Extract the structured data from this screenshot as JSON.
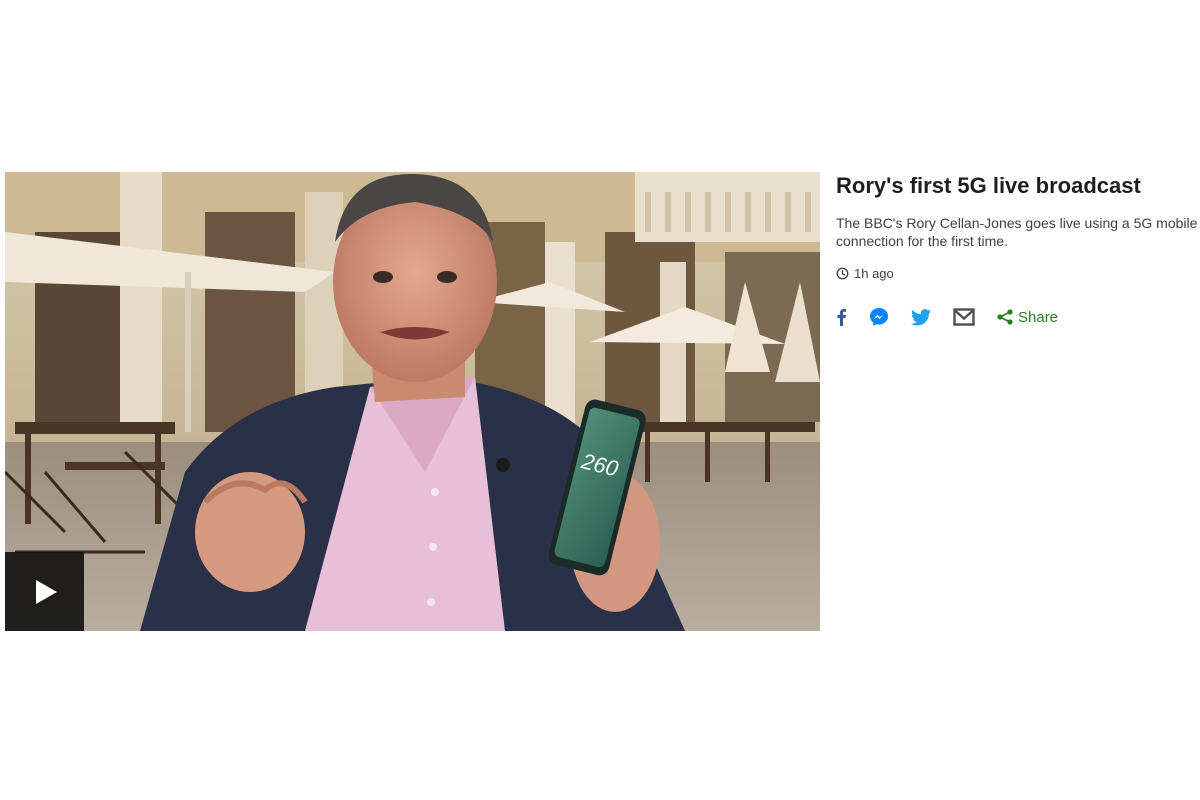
{
  "story": {
    "headline": "Rory's first 5G live broadcast",
    "summary": "The BBC's Rory Cellan-Jones goes live using a 5G mobile connection for the first time.",
    "timestamp": "1h ago"
  },
  "media": {
    "phone_readout": "260",
    "play_icon": "play-icon"
  },
  "share": {
    "label": "Share",
    "icons": [
      "facebook-icon",
      "messenger-icon",
      "twitter-icon",
      "email-icon",
      "share-icon"
    ]
  },
  "colors": {
    "headline": "#1e1e1e",
    "body_text": "#404040",
    "share_green": "#2b7a24",
    "facebook": "#3b5998",
    "messenger": "#0084ff",
    "twitter": "#1da1f2",
    "email": "#505050",
    "play_overlay": "#141414"
  }
}
